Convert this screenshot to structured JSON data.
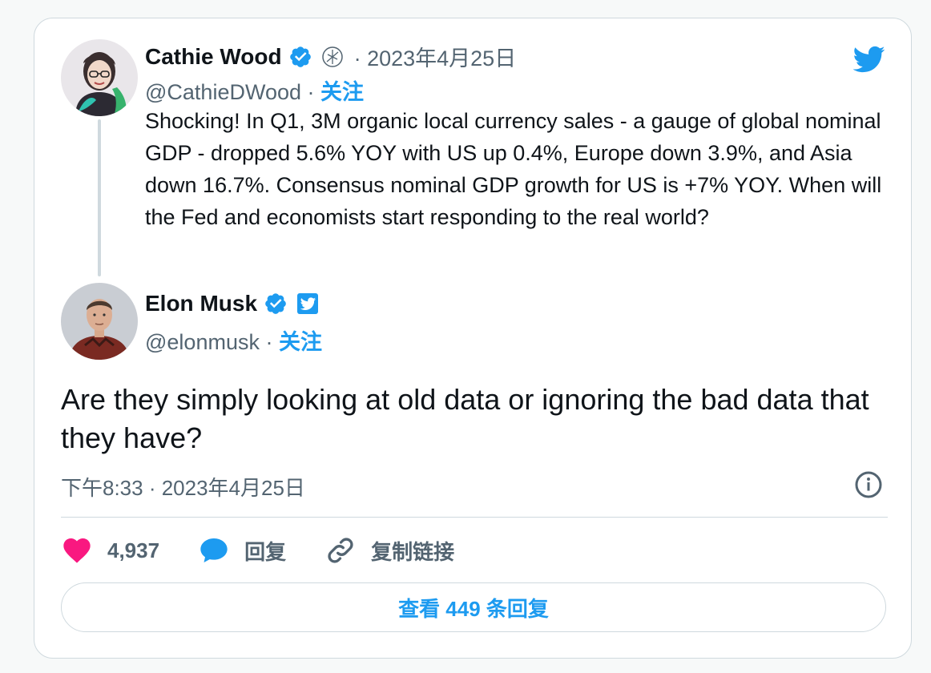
{
  "quoted_tweet": {
    "name": "Cathie Wood",
    "handle": "@CathieDWood",
    "date": "· 2023年4月25日",
    "follow_label": "关注",
    "text": "Shocking! In Q1, 3M organic local currency sales - a gauge of global nominal GDP - dropped 5.6% YOY with US up 0.4%, Europe down 3.9%, and Asia down 16.7%. Consensus nominal GDP growth for US is +7% YOY. When will the Fed and economists start responding to the real world?"
  },
  "main_tweet": {
    "name": "Elon Musk",
    "handle": "@elonmusk",
    "follow_label": "关注",
    "text": "Are they simply looking at old data or ignoring the bad data that they have?",
    "timestamp": "下午8:33 · 2023年4月25日"
  },
  "actions": {
    "like_count": "4,937",
    "reply_label": "回复",
    "copy_link_label": "复制链接"
  },
  "view_replies_label": "查看 449 条回复",
  "icons": {
    "brand": "twitter-bird-icon",
    "verified": "verified-badge-icon",
    "like": "heart-icon",
    "reply": "speech-bubble-icon",
    "link": "link-icon",
    "info": "info-icon"
  },
  "colors": {
    "accent": "#1d9bf0",
    "like": "#f91880",
    "text": "#0f1419",
    "muted": "#536471",
    "border": "#cfd9de"
  }
}
